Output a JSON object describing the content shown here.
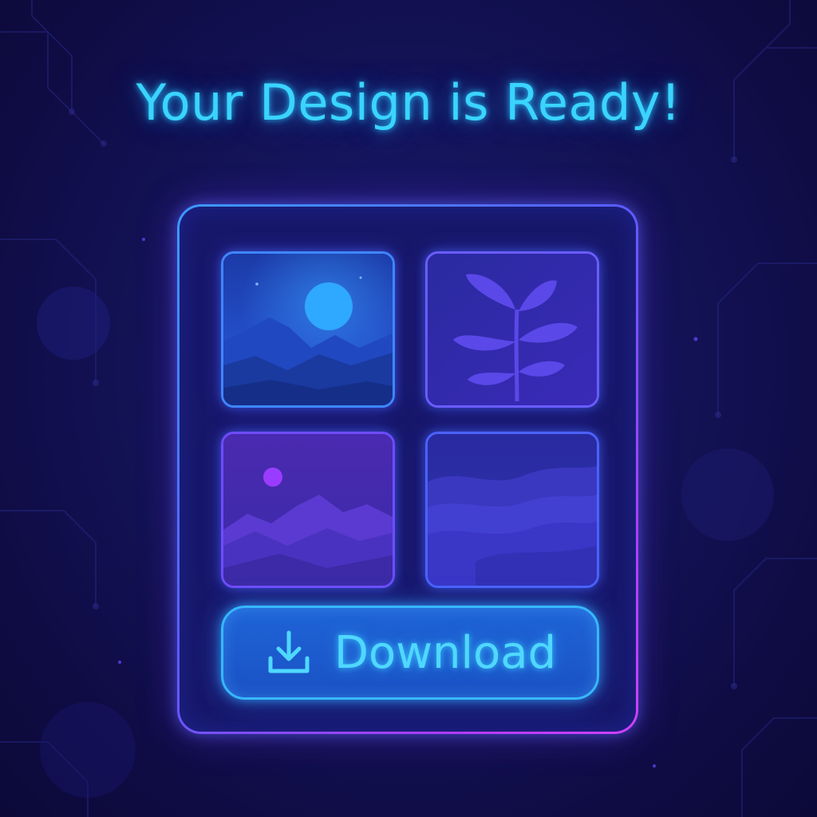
{
  "header": {
    "title": "Your Design is Ready!"
  },
  "gallery": {
    "tiles": [
      {
        "icon": "mountain-moon-icon"
      },
      {
        "icon": "leaf-plant-icon"
      },
      {
        "icon": "mountain-sunset-icon"
      },
      {
        "icon": "wave-landscape-icon"
      }
    ]
  },
  "download_button": {
    "label": "Download",
    "icon": "download-icon"
  },
  "colors": {
    "accent": "#3ad4ff",
    "background": "#14145a",
    "panel_border_start": "#3a9bff",
    "panel_border_end": "#d040ff",
    "button_fill": "#1f64d8"
  }
}
